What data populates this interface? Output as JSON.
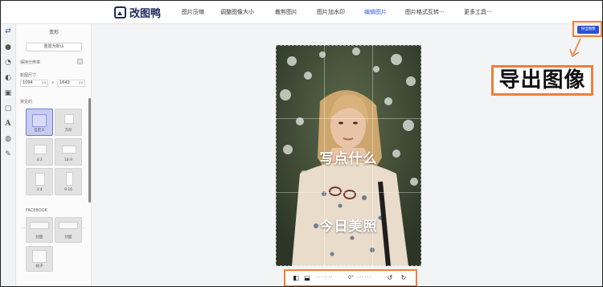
{
  "brand": {
    "name": "改图鸭"
  },
  "nav": [
    {
      "label": "图片压缩"
    },
    {
      "label": "调整图像大小"
    },
    {
      "label": "裁剪图片"
    },
    {
      "label": "图片加水印"
    },
    {
      "label": "编辑图片"
    },
    {
      "label": "图片格式互转···"
    },
    {
      "label": "更多工具···"
    }
  ],
  "nav_active_index": 4,
  "rail_icons": [
    "transform-icon",
    "drop-icon",
    "palette-icon",
    "brightness-icon",
    "frame-icon",
    "crop-box-icon",
    "text-icon",
    "sticker-icon",
    "brush-icon"
  ],
  "panel": {
    "title": "变形",
    "reset_label": "重置为默认",
    "keep_ratio_label": "保持分辨率",
    "canvas_size_label": "新图尺寸",
    "width_value": "1094",
    "height_value": "1643",
    "unit": "px",
    "times": "x",
    "common_label": "常见的",
    "presets": [
      {
        "label": "自定义"
      },
      {
        "label": "方形"
      },
      {
        "label": "4:3"
      },
      {
        "label": "16:9"
      },
      {
        "label": "3:4"
      },
      {
        "label": "9:16"
      }
    ],
    "facebook_label": "FACEBOOK",
    "fb_presets": [
      {
        "label": "封面"
      },
      {
        "label": "封面"
      },
      {
        "label": "帖子"
      }
    ]
  },
  "export": {
    "label": "导出图像"
  },
  "callout": {
    "text": "导出图像"
  },
  "overlay": {
    "text1": "写点什么",
    "text2": "今日美照"
  },
  "toolbar": {
    "rotation_label": "0°"
  },
  "colors": {
    "accent": "#2a52d8",
    "highlight": "#f07e3a"
  }
}
